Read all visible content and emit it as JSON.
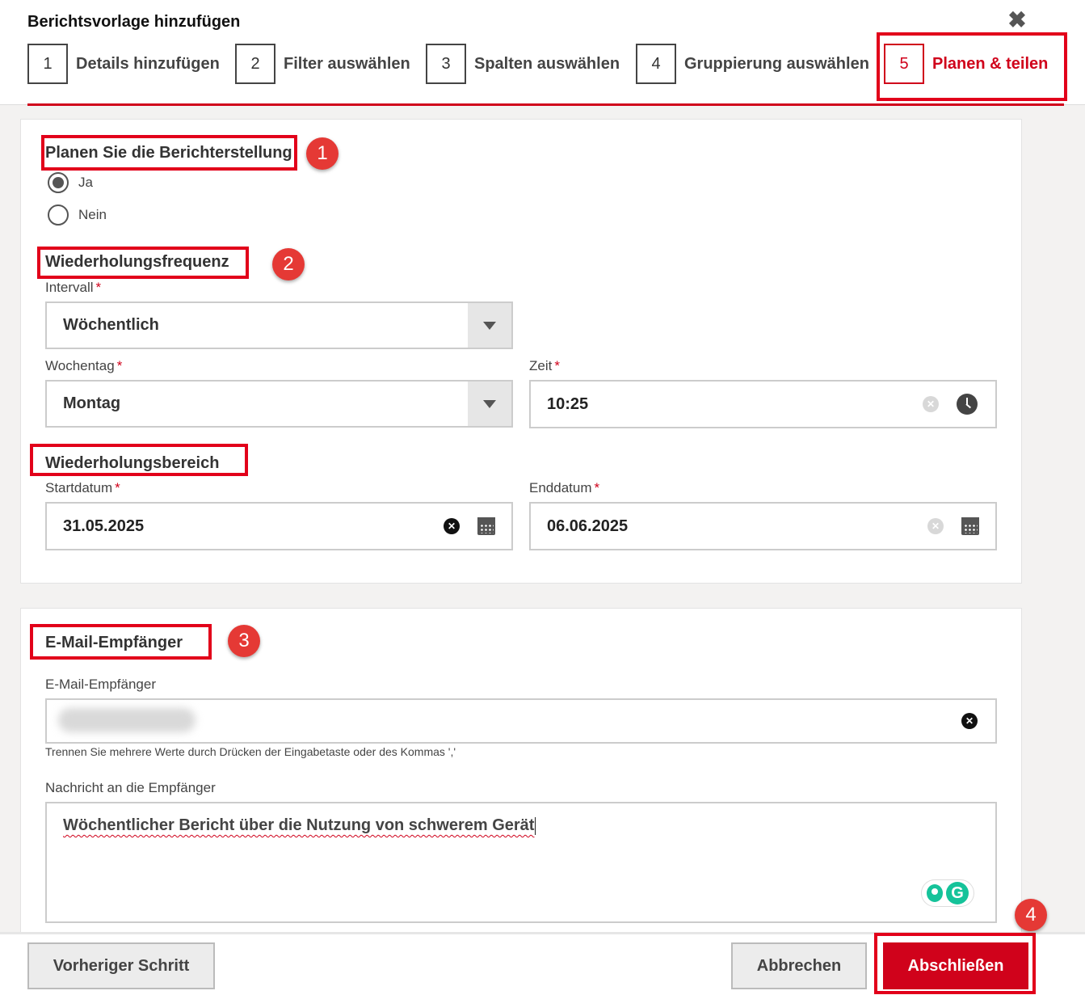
{
  "modal": {
    "title": "Berichtsvorlage hinzufügen",
    "close_icon": "close-icon"
  },
  "steps": [
    {
      "number": "1",
      "label": "Details hinzufügen",
      "active": false
    },
    {
      "number": "2",
      "label": "Filter auswählen",
      "active": false
    },
    {
      "number": "3",
      "label": "Spalten auswählen",
      "active": false
    },
    {
      "number": "4",
      "label": "Gruppierung auswählen",
      "active": false
    },
    {
      "number": "5",
      "label": "Planen & teilen",
      "active": true
    }
  ],
  "schedule": {
    "title": "Planen Sie die Berichterstellung",
    "options": [
      {
        "label": "Ja",
        "selected": true
      },
      {
        "label": "Nein",
        "selected": false
      }
    ]
  },
  "frequency": {
    "title": "Wiederholungsfrequenz",
    "interval_label": "Intervall",
    "interval_value": "Wöchentlich",
    "weekday_label": "Wochentag",
    "weekday_value": "Montag",
    "time_label": "Zeit",
    "time_value": "10:25"
  },
  "range": {
    "title": "Wiederholungsbereich",
    "start_label": "Startdatum",
    "start_value": "31.05.2025",
    "end_label": "Enddatum",
    "end_value": "06.06.2025"
  },
  "email": {
    "title": "E-Mail-Empfänger",
    "recipients_label": "E-Mail-Empfänger",
    "helper": "Trennen Sie mehrere Werte durch Drücken der Eingabetaste oder des Kommas ','",
    "message_label": "Nachricht an die Empfänger",
    "message_value": "Wöchentlicher Bericht über die Nutzung von schwerem Gerät"
  },
  "required_marker": "*",
  "annotations": {
    "badges": [
      "1",
      "2",
      "3",
      "4"
    ],
    "color": "#e2001a"
  },
  "footer": {
    "previous": "Vorheriger Schritt",
    "cancel": "Abbrechen",
    "finish": "Abschließen"
  },
  "colors": {
    "accent": "#d0021b",
    "background": "#f3f2f1"
  }
}
